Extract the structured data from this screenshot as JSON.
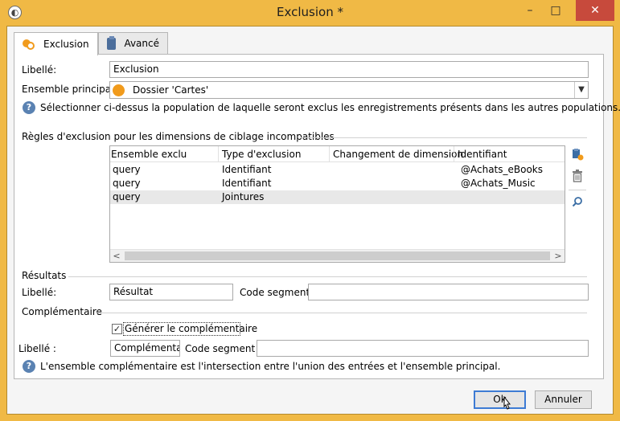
{
  "window": {
    "title": "Exclusion *",
    "app_icon_glyph": "◐",
    "minimize_glyph": "–",
    "maximize_glyph": "□",
    "close_glyph": "✕",
    "frame_color": "#f0b945",
    "close_color": "#c74a3c"
  },
  "tabs": [
    {
      "label": "Exclusion",
      "active": true
    },
    {
      "label": "Avancé",
      "active": false
    }
  ],
  "form": {
    "libelle_label": "Libellé:",
    "libelle_value": "Exclusion",
    "ensemble_label": "Ensemble principal:",
    "ensemble_value": "Dossier 'Cartes'",
    "help_glyph": "?",
    "help_text": "Sélectionner ci-dessus la population de laquelle seront exclus les enregistrements présents dans les autres populations."
  },
  "rules": {
    "section_title": "Règles d'exclusion pour les dimensions de ciblage incompatibles",
    "columns": [
      "Ensemble exclu",
      "Type d'exclusion",
      "Changement de dimension",
      "Identifiant"
    ],
    "rows": [
      {
        "ensemble": "query",
        "type": "Identifiant",
        "changement": "",
        "identifiant": "@Achats_eBooks"
      },
      {
        "ensemble": "query",
        "type": "Identifiant",
        "changement": "",
        "identifiant": "@Achats_Music"
      },
      {
        "ensemble": "query",
        "type": "Jointures",
        "changement": "",
        "identifiant": ""
      }
    ],
    "selected_row": 2,
    "scroll_left_glyph": "<",
    "scroll_right_glyph": ">",
    "add_glyph": "▪",
    "delete_glyph": "🗑",
    "search_glyph": "⌕"
  },
  "results": {
    "section_title": "Résultats",
    "libelle_label": "Libellé:",
    "libelle_value": "Résultat",
    "code_label": "Code segment:",
    "code_value": ""
  },
  "complement": {
    "section_title": "Complémentaire",
    "checkbox_label": "Générer le complémentaire",
    "checkbox_checked": true,
    "check_glyph": "✓",
    "libelle_label": "Libellé :",
    "libelle_value": "Complémentair",
    "code_label": "Code segment :",
    "code_value": "",
    "help_text": "L'ensemble complémentaire est l'intersection entre l'union des entrées et l'ensemble principal."
  },
  "buttons": {
    "ok": "Ok",
    "cancel": "Annuler"
  }
}
